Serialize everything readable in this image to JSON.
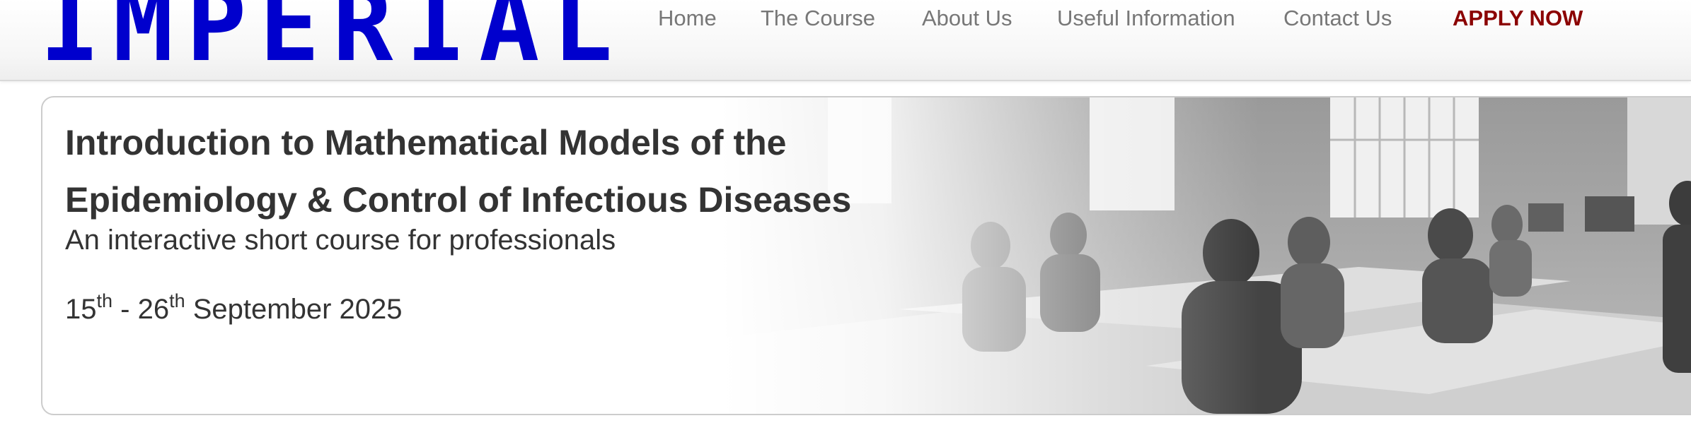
{
  "header": {
    "logo_text": "IMPERIAL",
    "logo_color": "#0000cd",
    "nav": [
      {
        "label": "Home"
      },
      {
        "label": "The Course"
      },
      {
        "label": "About Us"
      },
      {
        "label": "Useful Information"
      },
      {
        "label": "Contact Us"
      },
      {
        "label": "APPLY NOW",
        "color": "#8b0000"
      }
    ]
  },
  "hero": {
    "title_line1": "Introduction to Mathematical Models of the",
    "title_line2": "Epidemiology & Control of Infectious Diseases",
    "subtitle": "An interactive short course for professionals",
    "dates": {
      "start_day": "15",
      "start_suffix": "th",
      "separator": " - ",
      "end_day": "26",
      "end_suffix": "th",
      "month_year": " September 2025"
    },
    "image": "classroom-photo"
  }
}
